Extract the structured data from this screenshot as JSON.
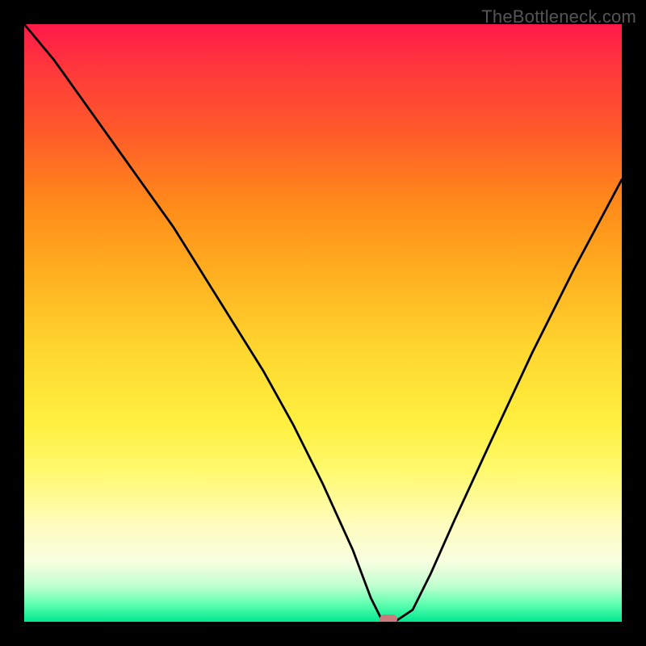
{
  "watermark": "TheBottleneck.com",
  "chart_data": {
    "type": "line",
    "title": "",
    "xlabel": "",
    "ylabel": "",
    "xlim": [
      0,
      100
    ],
    "ylim": [
      0,
      100
    ],
    "note": "V-shaped bottleneck curve over a red-to-green vertical gradient. Values are estimated percentage offsets (x: position across plot, y: distance from bottom).",
    "series": [
      {
        "name": "bottleneck-curve",
        "x": [
          0,
          5,
          10,
          15,
          20,
          25,
          30,
          35,
          40,
          45,
          50,
          55,
          58,
          60,
          62,
          65,
          68,
          72,
          78,
          85,
          92,
          100
        ],
        "y": [
          100,
          94,
          87,
          80,
          73,
          66,
          58,
          50,
          42,
          33,
          23,
          12,
          4,
          0,
          0,
          2,
          8,
          17,
          30,
          45,
          59,
          74
        ]
      }
    ],
    "marker": {
      "x": 61,
      "y": 0,
      "label": "optimal-point"
    },
    "gradient_stops": [
      {
        "pos": 0,
        "color": "#ff1a4a"
      },
      {
        "pos": 50,
        "color": "#ffd830"
      },
      {
        "pos": 90,
        "color": "#f8ffe0"
      },
      {
        "pos": 100,
        "color": "#00e890"
      }
    ]
  }
}
